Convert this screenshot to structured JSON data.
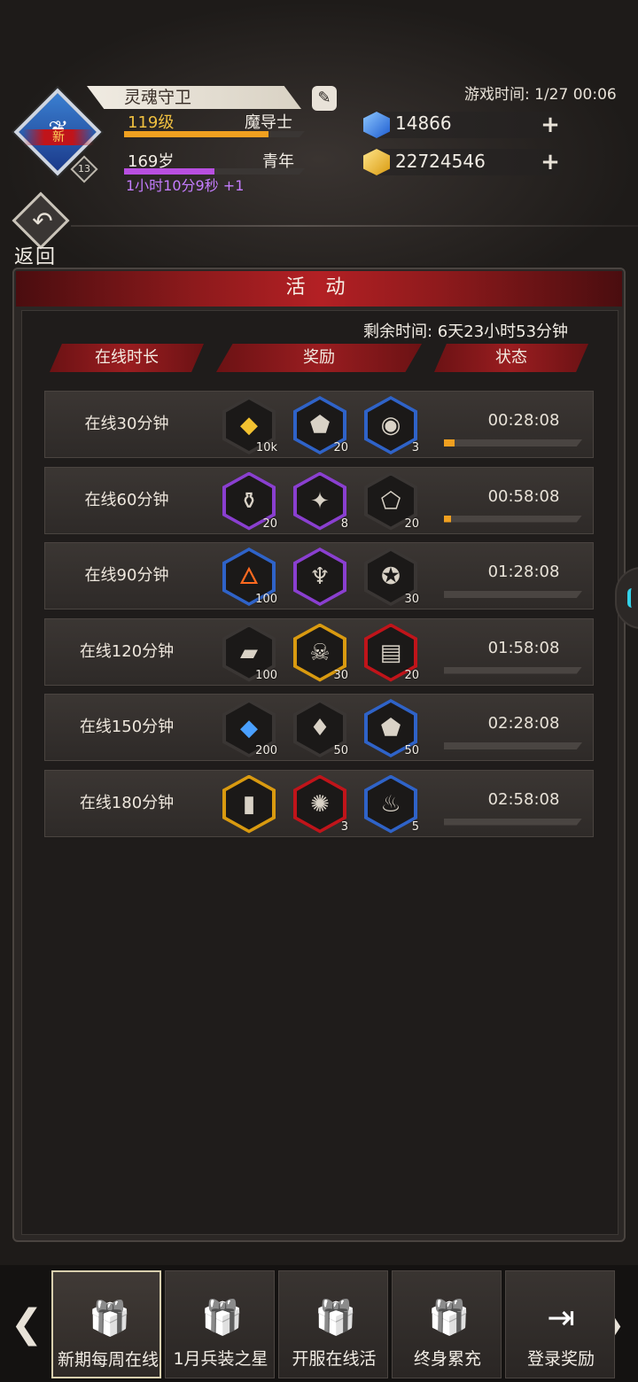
{
  "player": {
    "name": "灵魂守卫",
    "level": "119级",
    "class": "魔导士",
    "age": "169岁",
    "stage": "青年",
    "timer": "1小时10分9秒 +1",
    "badge_new": "新",
    "rank": "13",
    "level_progress": 0.8,
    "age_progress": 0.5
  },
  "game_time": "游戏时间: 1/27 00:06",
  "currency": {
    "diamond": "14866",
    "gold": "22724546"
  },
  "back_label": "返回",
  "panel": {
    "title": "活 动",
    "remaining": "剩余时间: 6天23小时53分钟",
    "columns": [
      "在线时长",
      "奖励",
      "状态"
    ]
  },
  "rows": [
    {
      "title": "在线30分钟",
      "time": "00:28:08",
      "progress": 0.08,
      "items": [
        {
          "icon": "gold-gem-icon",
          "qty": "10k"
        },
        {
          "icon": "ore-icon",
          "qty": "20"
        },
        {
          "icon": "compass-icon",
          "qty": "3"
        }
      ]
    },
    {
      "title": "在线60分钟",
      "time": "00:58:08",
      "progress": 0.05,
      "items": [
        {
          "icon": "potion-jar-icon",
          "qty": "20"
        },
        {
          "icon": "crystal-shards-icon",
          "qty": "8"
        },
        {
          "icon": "stone-fragment-icon",
          "qty": "20"
        }
      ]
    },
    {
      "title": "在线90分钟",
      "time": "01:28:08",
      "progress": 0,
      "items": [
        {
          "icon": "torch-icon",
          "qty": "100"
        },
        {
          "icon": "chalice-icon",
          "qty": ""
        },
        {
          "icon": "star-coin-icon",
          "qty": "30"
        }
      ]
    },
    {
      "title": "在线120分钟",
      "time": "01:58:08",
      "progress": 0,
      "items": [
        {
          "icon": "scroll-piece-icon",
          "qty": "100"
        },
        {
          "icon": "skull-crossbones-icon",
          "qty": "30"
        },
        {
          "icon": "map-scroll-icon",
          "qty": "20"
        }
      ]
    },
    {
      "title": "在线150分钟",
      "time": "02:28:08",
      "progress": 0,
      "items": [
        {
          "icon": "blue-gem-icon",
          "qty": "200"
        },
        {
          "icon": "crystal-icon",
          "qty": "50"
        },
        {
          "icon": "ore-icon",
          "qty": "50"
        }
      ]
    },
    {
      "title": "在线180分钟",
      "time": "02:58:08",
      "progress": 0,
      "items": [
        {
          "icon": "banner-icon",
          "qty": ""
        },
        {
          "icon": "emblem-icon",
          "qty": "3"
        },
        {
          "icon": "flame-icon",
          "qty": "5"
        }
      ]
    }
  ],
  "tabs": [
    {
      "label": "新期每周在线",
      "icon": "gift-icon"
    },
    {
      "label": "1月兵装之星",
      "icon": "gift-icon"
    },
    {
      "label": "开服在线活",
      "icon": "gift-icon"
    },
    {
      "label": "终身累充",
      "icon": "gift-icon"
    },
    {
      "label": "登录奖励",
      "icon": "login-icon"
    }
  ],
  "colors": {
    "accent_red": "#b32024",
    "level_bar": "#f0a020",
    "age_bar": "#b84fe0",
    "timer_text": "#c57dff"
  }
}
